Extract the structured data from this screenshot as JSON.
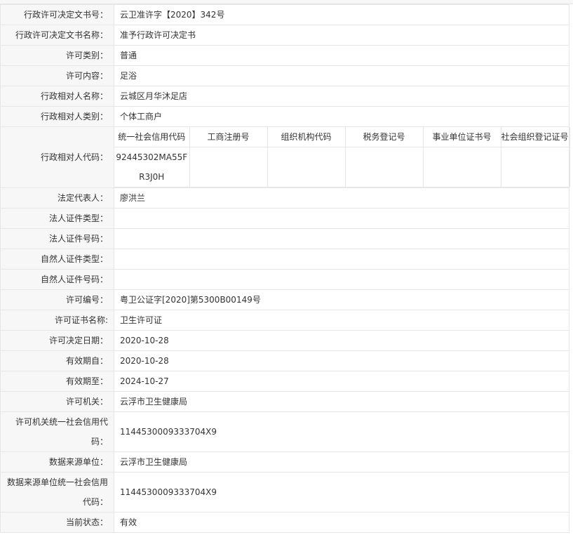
{
  "rows_top": [
    {
      "label": "行政许可决定文书号：",
      "value": "云卫准许字【2020】342号"
    },
    {
      "label": "行政许可决定文书名称：",
      "value": "准予行政许可决定书"
    },
    {
      "label": "许可类别：",
      "value": "普通"
    },
    {
      "label": "许可内容：",
      "value": "足浴"
    },
    {
      "label": "行政相对人名称：",
      "value": "云城区月华沐足店"
    },
    {
      "label": "行政相对人类别：",
      "value": "个体工商户"
    }
  ],
  "code_block": {
    "label": "行政相对人代码：",
    "headers": [
      "统一社会信用代码",
      "工商注册号",
      "组织机构代码",
      "税务登记号",
      "事业单位证书号",
      "社会组织登记证号"
    ],
    "values": [
      "92445302MA55FR3J0H",
      "",
      "",
      "",
      "",
      ""
    ]
  },
  "rows_bottom": [
    {
      "label": "法定代表人：",
      "value": "廖洪兰"
    },
    {
      "label": "法人证件类型：",
      "value": ""
    },
    {
      "label": "法人证件号码：",
      "value": ""
    },
    {
      "label": "自然人证件类型：",
      "value": ""
    },
    {
      "label": "自然人证件号码：",
      "value": ""
    },
    {
      "label": "许可编号：",
      "value": "粤卫公证字[2020]第5300B00149号"
    },
    {
      "label": "许可证书名称:",
      "value": "卫生许可证"
    },
    {
      "label": "许可决定日期：",
      "value": "2020-10-28"
    },
    {
      "label": "有效期自：",
      "value": "2020-10-28"
    },
    {
      "label": "有效期至：",
      "value": "2024-10-27"
    },
    {
      "label": "许可机关：",
      "value": "云浮市卫生健康局"
    }
  ],
  "authority_code": {
    "label": "许可机关统一社会信用代码：",
    "value": "1144530009333704X9"
  },
  "data_source": {
    "label": "数据来源单位：",
    "value": "云浮市卫生健康局"
  },
  "data_source_code": {
    "label": "数据来源单位统一社会信用代码：",
    "value": "1144530009333704X9"
  },
  "status": {
    "label": "当前状态：",
    "value": "有效"
  }
}
